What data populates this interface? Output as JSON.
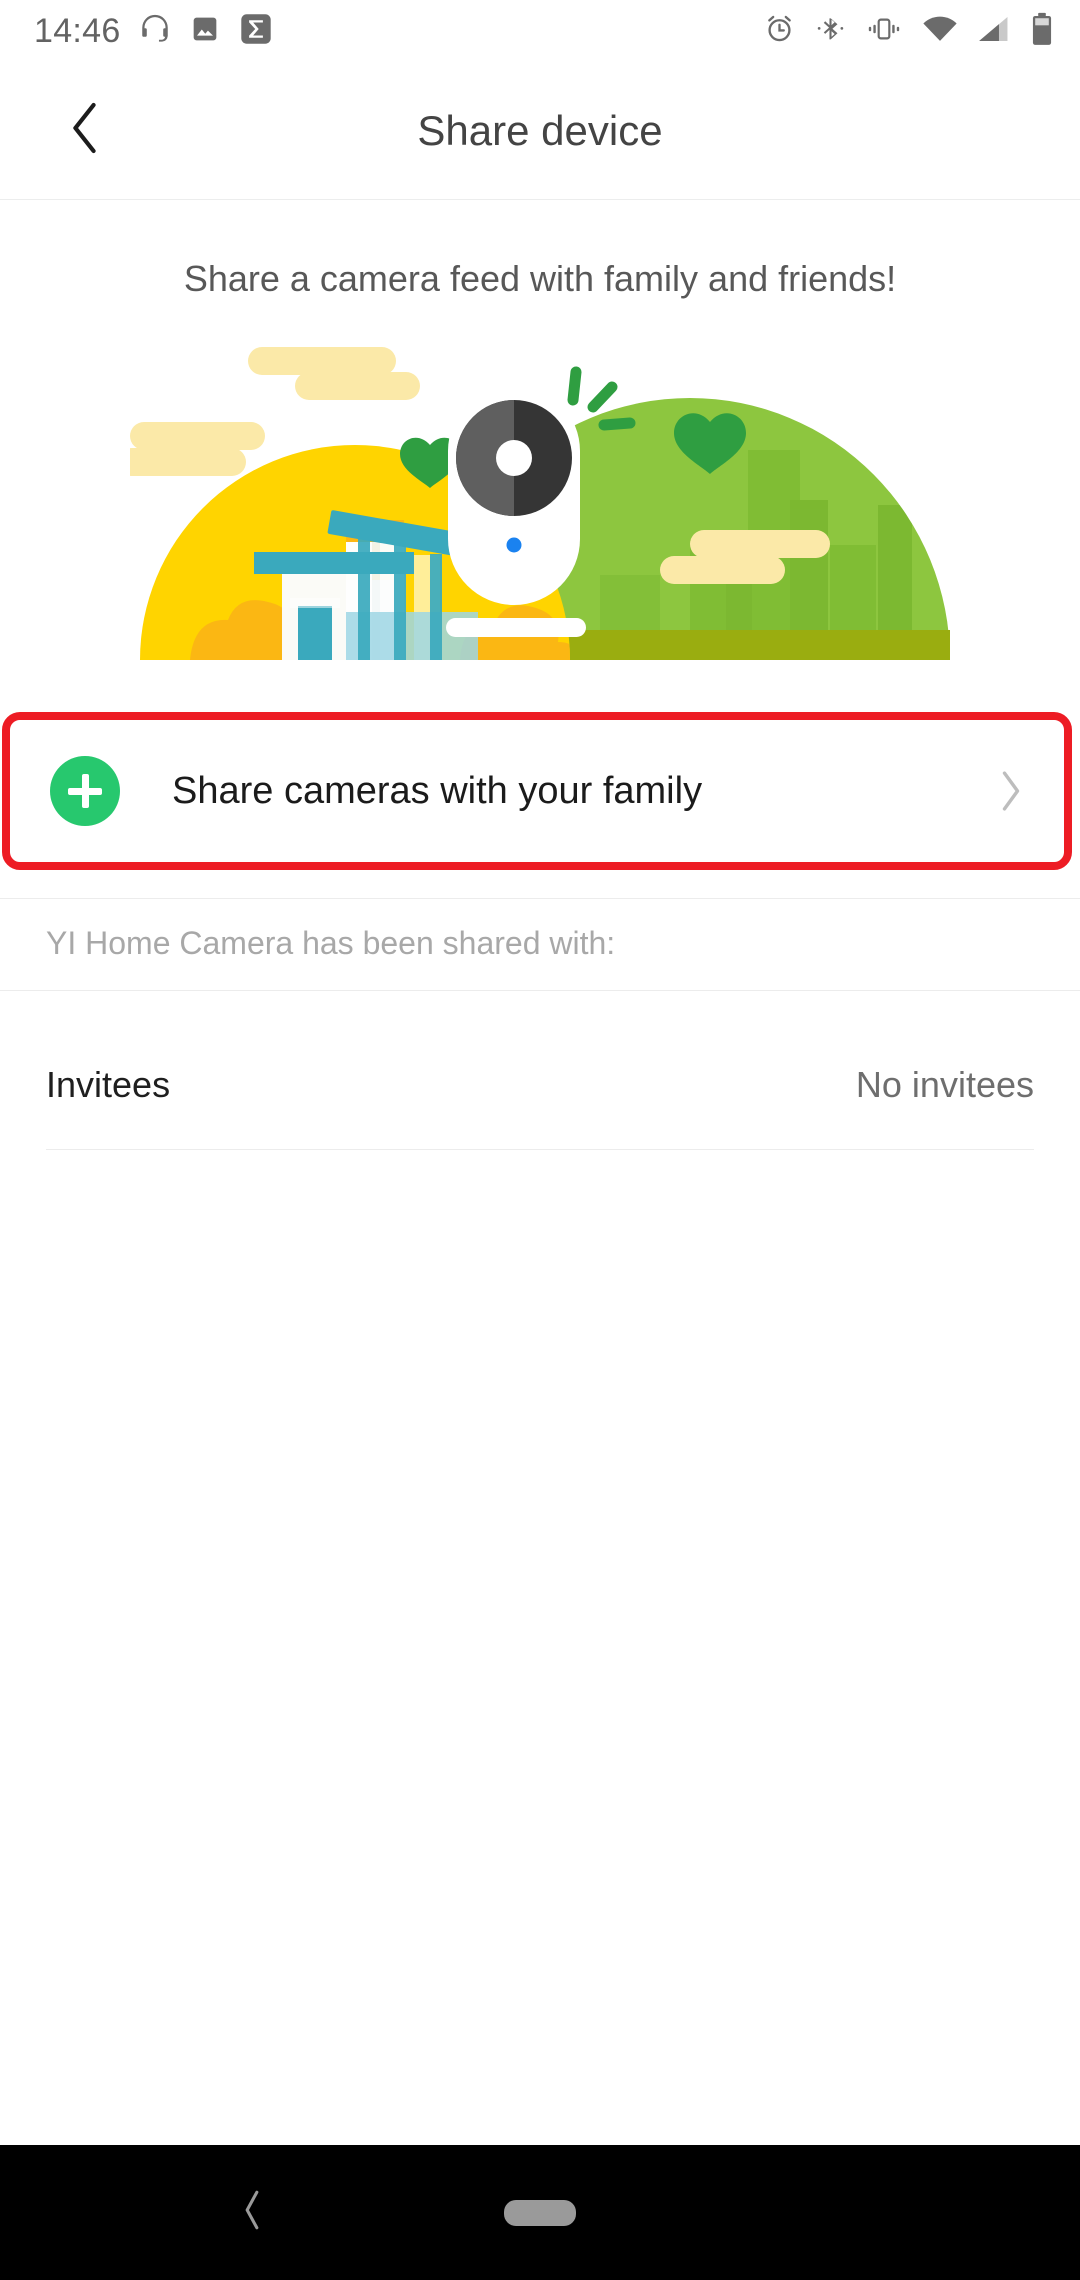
{
  "status_bar": {
    "time": "14:46",
    "left_icons": [
      "headset-icon",
      "image-icon",
      "sigma-app-icon"
    ],
    "right_icons": [
      "alarm-icon",
      "bluetooth-icon",
      "vibrate-icon",
      "wifi-icon",
      "cellular-signal-icon",
      "battery-icon"
    ],
    "icon_color": "#6b6b6b"
  },
  "header": {
    "back_icon": "chevron-left-icon",
    "title": "Share device"
  },
  "content": {
    "subtitle": "Share a camera feed with family and friends!",
    "illustration": {
      "name": "share-camera-illustration",
      "elements": [
        "yellow-hill",
        "green-hill",
        "house",
        "camera-device",
        "hearts",
        "clouds",
        "signal-dashes"
      ],
      "colors": {
        "yellow_hill": "#ffd400",
        "yellow_hill_dark": "#fbb713",
        "green_hill": "#8dc63f",
        "green_hill_dark": "#7ab52f",
        "green_ground": "#9aad10",
        "cloud": "#fbe9a8",
        "heart": "#2f9e41",
        "camera_body": "#ffffff",
        "camera_lens": "#353535",
        "camera_lens_light": "#5f5f5f",
        "led": "#1a82f0",
        "teal": "#3aa9bd",
        "teal_light": "#9ed6e4"
      }
    }
  },
  "share_action": {
    "plus_icon": "plus-circle-icon",
    "label": "Share cameras with your family",
    "chevron_icon": "chevron-right-icon",
    "accent_color": "#27c86e",
    "highlight_color": "#ed1c24",
    "highlighted": true
  },
  "shared_section": {
    "heading": "YI Home Camera has been shared with:",
    "rows": [
      {
        "label": "Invitees",
        "value": "No invitees"
      }
    ]
  },
  "nav_bar": {
    "back_icon": "nav-back-icon",
    "home_icon": "nav-home-pill",
    "background": "#000000"
  }
}
